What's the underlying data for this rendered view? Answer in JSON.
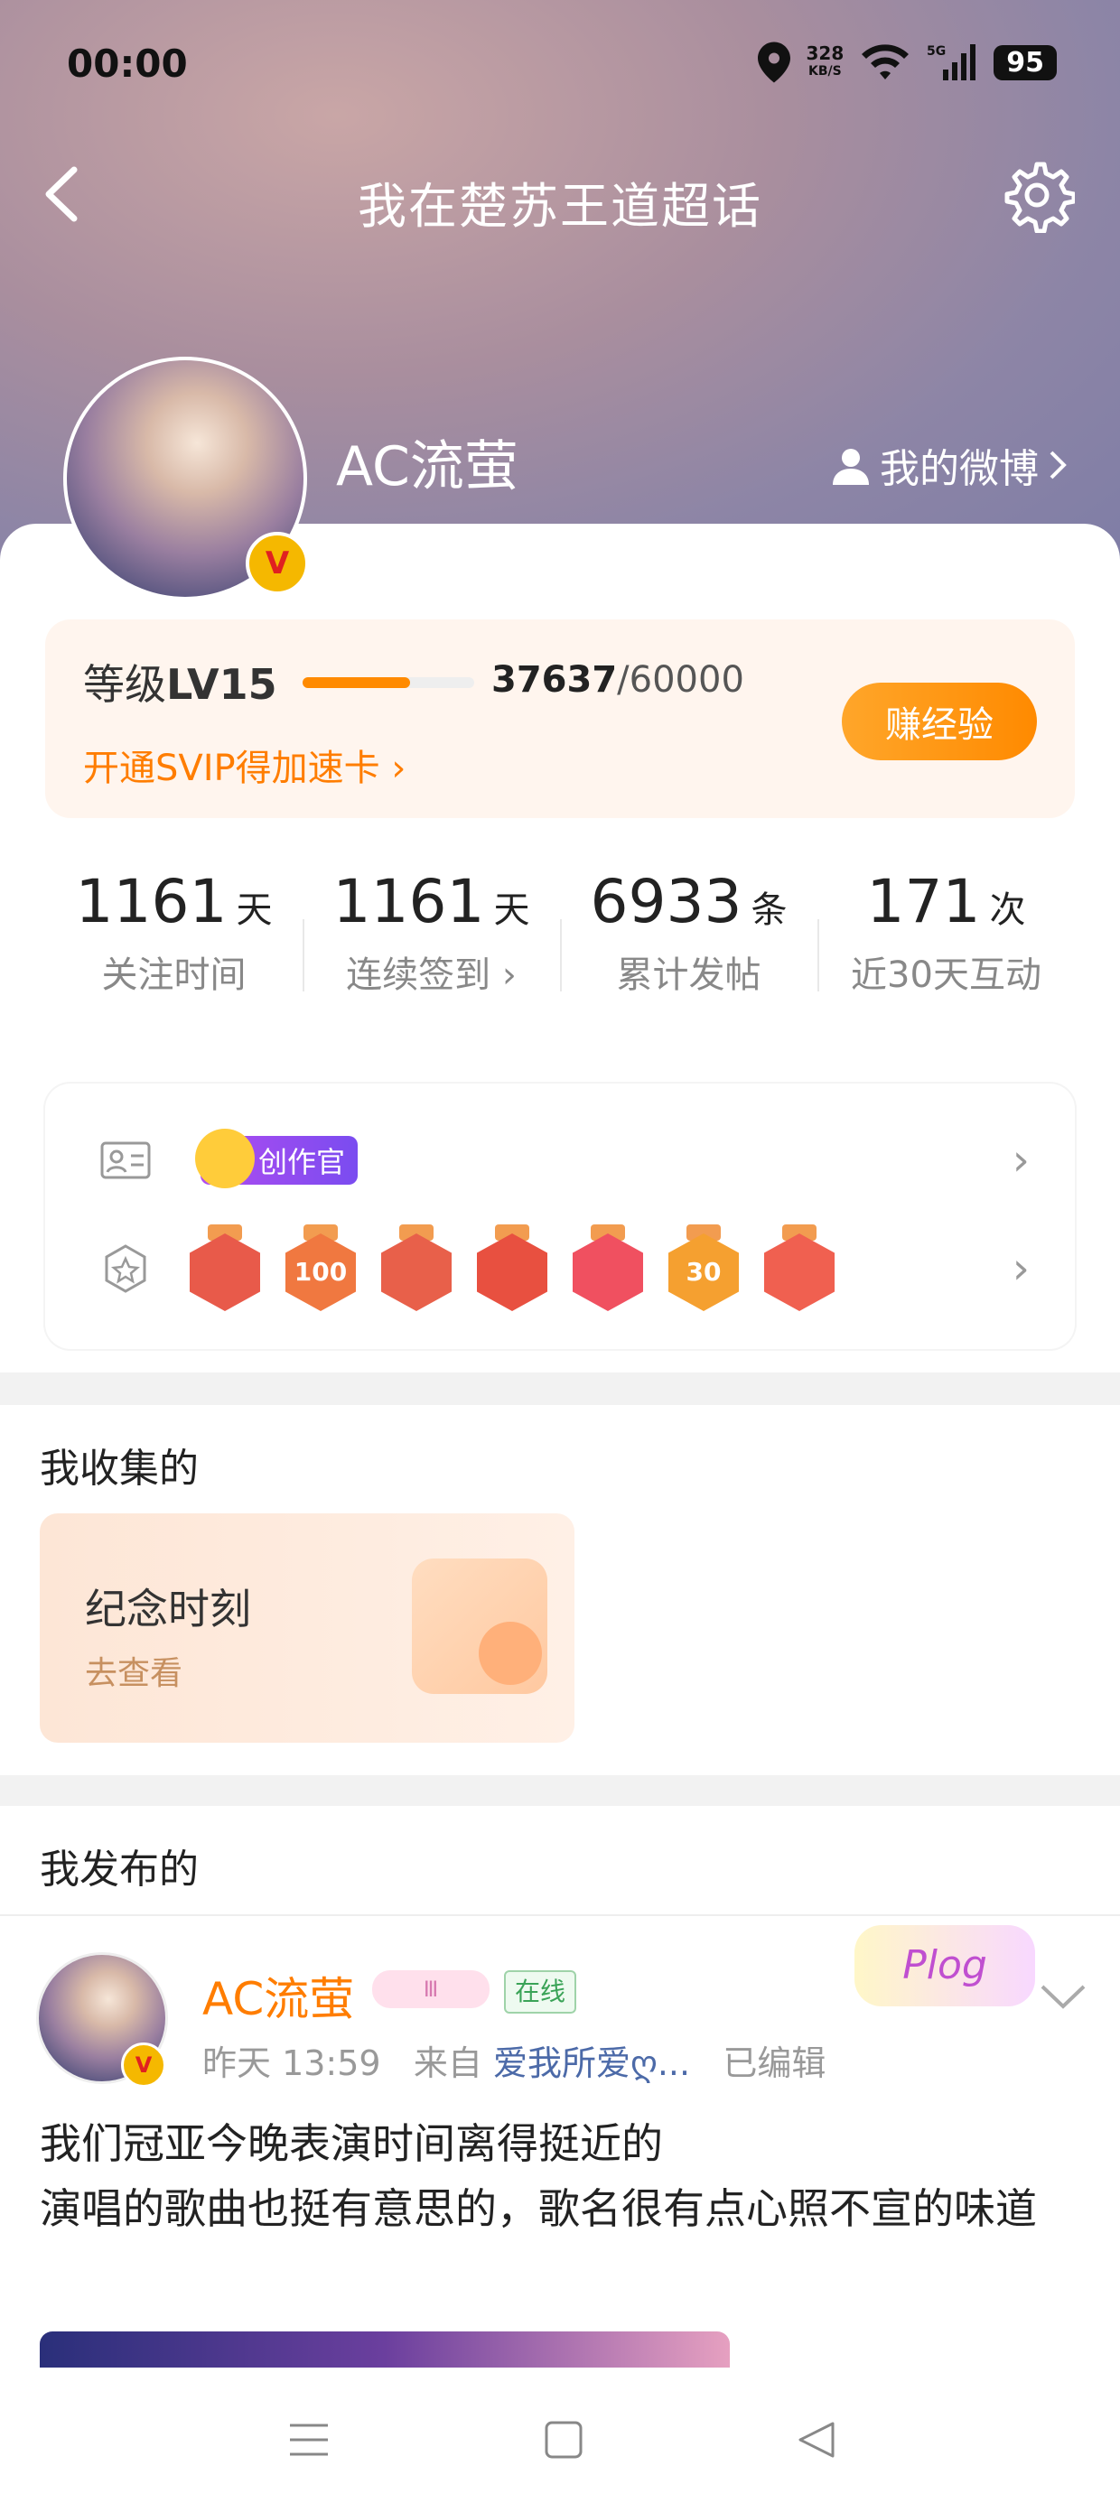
{
  "status_bar": {
    "time": "00:00",
    "speed_value": "328",
    "speed_unit": "KB/S",
    "network": "5G",
    "battery": "95"
  },
  "header": {
    "title": "我在楚苏王道超话"
  },
  "profile": {
    "username": "AC流萤",
    "my_weibo": "我的微博",
    "verified_badge": "V"
  },
  "level": {
    "label_prefix": "等级",
    "level": "LV15",
    "exp_current": "37637",
    "exp_total": "/60000",
    "progress": 0.627,
    "svip_text": "开通SVIP得加速卡",
    "earn_button": "赚经验"
  },
  "stats": [
    {
      "value": "1161",
      "unit": "天",
      "label": "关注时间"
    },
    {
      "value": "1161",
      "unit": "天",
      "label": "连续签到"
    },
    {
      "value": "6933",
      "unit": "条",
      "label": "累计发帖"
    },
    {
      "value": "171",
      "unit": "次",
      "label": "近30天互动"
    }
  ],
  "badges": {
    "creator_tag": "创作官",
    "medals": [
      "",
      "100",
      "",
      "",
      "",
      "30",
      ""
    ]
  },
  "collected": {
    "title": "我收集的",
    "memo_title": "纪念时刻",
    "memo_link": "去查看"
  },
  "published": {
    "title": "我发布的"
  },
  "post": {
    "author": "AC流萤",
    "level_tag": "Ⅲ",
    "online": "在线",
    "plog": "Plog",
    "time": "昨天 13:59",
    "source_prefix": "来自",
    "source": "爱我所爱ღ...",
    "edited": "已编辑",
    "text": "我们冠亚今晚表演时间离得挺近的\n演唱的歌曲也挺有意思的，歌名很有点心照不宣的味道"
  },
  "colors": {
    "accent": "#ff7d00",
    "vip_gold": "#f5b800",
    "link_blue": "#4c6aa8"
  }
}
